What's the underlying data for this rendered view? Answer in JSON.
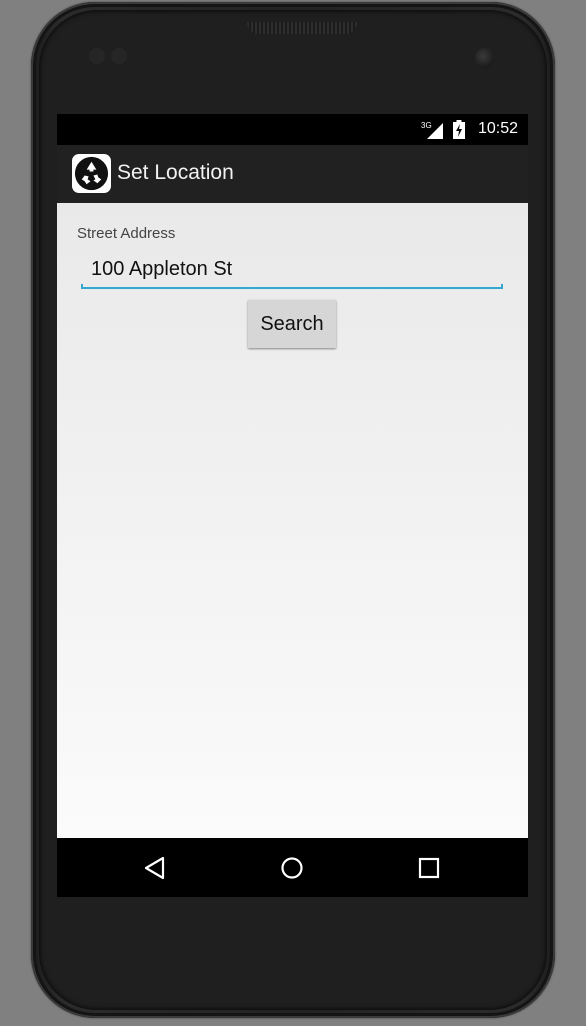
{
  "status_bar": {
    "network": "3G",
    "time": "10:52"
  },
  "action_bar": {
    "title": "Set Location",
    "icon": "recycle-icon"
  },
  "form": {
    "street_label": "Street Address",
    "street_value": "100 Appleton St",
    "search_label": "Search"
  },
  "nav": {
    "back_icon": "back-triangle-icon",
    "home_icon": "home-circle-icon",
    "recents_icon": "recents-square-icon"
  },
  "colors": {
    "accent": "#33a7d0",
    "action_bar": "#212121",
    "button": "#d6d6d6"
  }
}
